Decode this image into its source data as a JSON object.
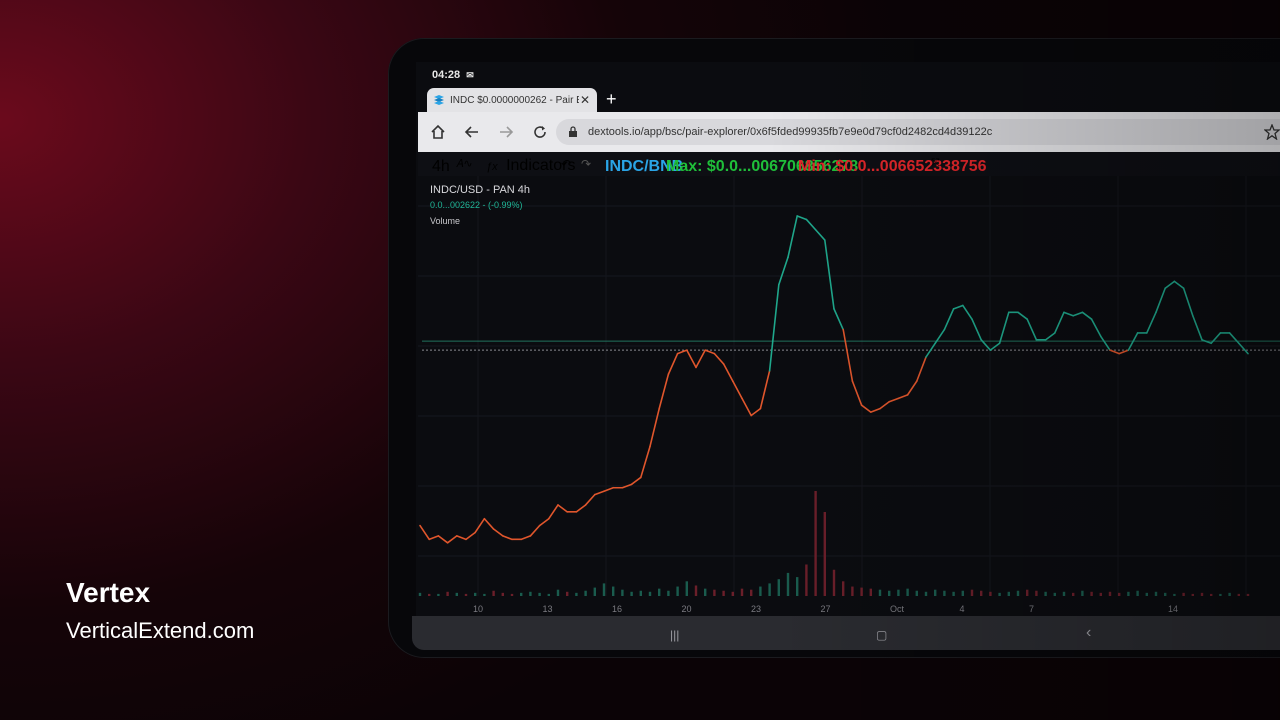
{
  "brand": {
    "name": "Vertex",
    "url": "VerticalExtend.com"
  },
  "device": {
    "status_time": "04:28",
    "status_icon": "gmail-icon"
  },
  "browser": {
    "tab_title": "INDC $0.0000000262 - Pair E",
    "new_tab": "+",
    "url": "dextools.io/app/bsc/pair-explorer/0x6f5fded99935fb7e9e0d79cf0d2482cd4d39122c"
  },
  "chart_toolbar": {
    "interval": "4h",
    "indicators": "Indicators",
    "pair": "INDC/BNB",
    "max": "Max: $0.0...006706856278",
    "min": "Min: $0.0...006652338756",
    "colors": {
      "pair": "#2aa4e6",
      "max": "#1fbf3a",
      "min": "#e0262a"
    }
  },
  "chart_data": {
    "type": "line",
    "title": "INDC/USD - PAN  4h",
    "price_readout": "0.0...002622 - (-0.99%)",
    "volume_label": "Volume",
    "x_ticks": [
      "10",
      "13",
      "16",
      "20",
      "23",
      "27",
      "Oct",
      "4",
      "7",
      "",
      "14"
    ],
    "colors": {
      "up": "#1fa88c",
      "down": "#e0562c",
      "baseline": "#2a9c7e"
    },
    "series": [
      {
        "values": [
          10,
          6,
          7,
          5,
          7,
          6,
          8,
          12,
          9,
          7,
          6,
          6,
          7,
          10,
          12,
          16,
          14,
          14,
          16,
          19,
          20,
          21,
          21,
          22,
          24,
          33,
          44,
          54,
          60,
          61,
          56,
          61,
          60,
          57,
          52,
          47,
          42,
          44,
          55,
          80,
          88,
          100,
          99,
          96,
          93,
          73,
          67,
          52,
          45,
          43,
          44,
          46,
          47,
          48,
          52,
          59,
          63,
          67,
          73,
          74,
          70,
          64,
          61,
          63,
          72,
          72,
          70,
          64,
          64,
          66,
          72,
          71,
          72,
          70,
          65,
          61,
          60,
          61,
          66,
          66,
          72,
          79,
          81,
          79,
          71,
          64,
          63,
          66,
          66,
          63,
          60
        ]
      }
    ],
    "baseline_value": 61,
    "volume": [
      3,
      2,
      2,
      4,
      3,
      2,
      3,
      2,
      5,
      3,
      2,
      3,
      4,
      3,
      2,
      6,
      4,
      3,
      5,
      8,
      12,
      9,
      6,
      4,
      5,
      4,
      7,
      5,
      9,
      14,
      10,
      7,
      6,
      5,
      4,
      7,
      6,
      9,
      12,
      16,
      22,
      18,
      30,
      100,
      80,
      25,
      14,
      9,
      8,
      7,
      6,
      5,
      6,
      7,
      5,
      4,
      6,
      5,
      4,
      5,
      6,
      5,
      4,
      3,
      4,
      5,
      6,
      5,
      4,
      3,
      4,
      3,
      5,
      4,
      3,
      4,
      3,
      4,
      5,
      3,
      4,
      3,
      2,
      3,
      2,
      3,
      2,
      2,
      3,
      2,
      2
    ]
  },
  "android_nav": {
    "recents": "|||",
    "home": "▢",
    "back": "‹"
  }
}
